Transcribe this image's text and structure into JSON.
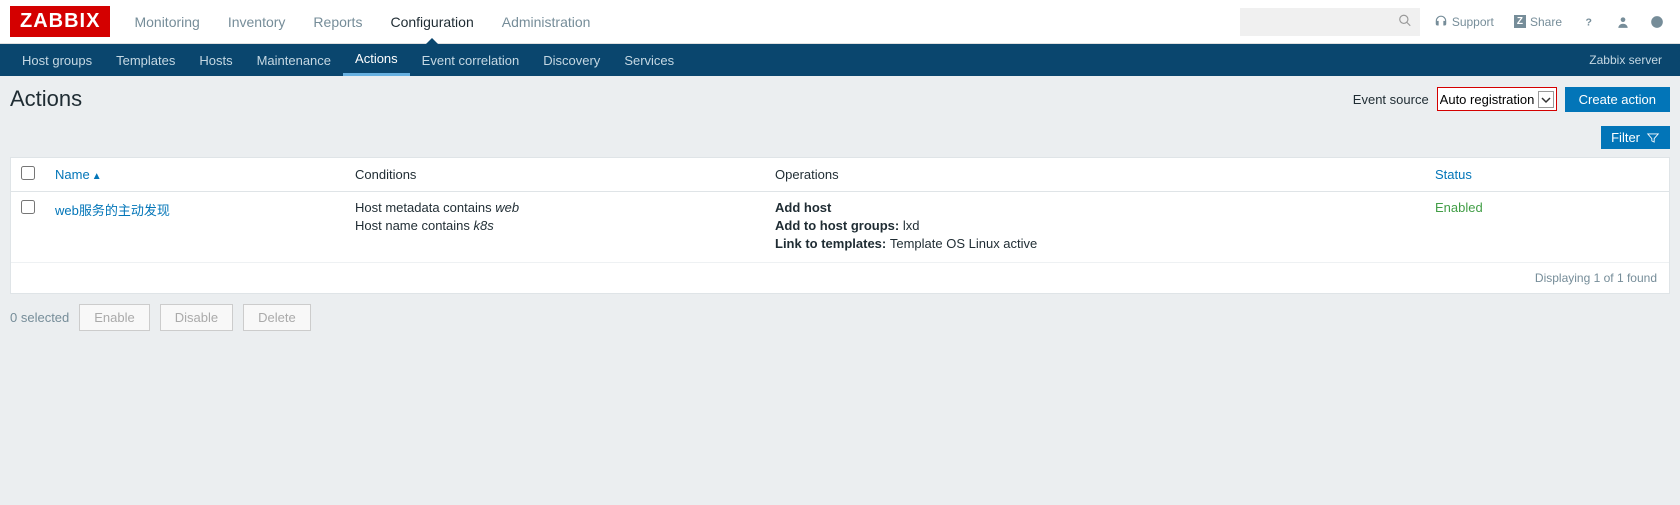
{
  "logo": "ZABBIX",
  "topnav": {
    "items": [
      {
        "label": "Monitoring"
      },
      {
        "label": "Inventory"
      },
      {
        "label": "Reports"
      },
      {
        "label": "Configuration"
      },
      {
        "label": "Administration"
      }
    ],
    "support": "Support",
    "share": "Share"
  },
  "subnav": {
    "items": [
      {
        "label": "Host groups"
      },
      {
        "label": "Templates"
      },
      {
        "label": "Hosts"
      },
      {
        "label": "Maintenance"
      },
      {
        "label": "Actions"
      },
      {
        "label": "Event correlation"
      },
      {
        "label": "Discovery"
      },
      {
        "label": "Services"
      }
    ],
    "server": "Zabbix server"
  },
  "page": {
    "title": "Actions",
    "event_source_label": "Event source",
    "event_source_value": "Auto registration",
    "create_button": "Create action",
    "filter_button": "Filter"
  },
  "table": {
    "headers": {
      "name": "Name",
      "conditions": "Conditions",
      "operations": "Operations",
      "status": "Status"
    },
    "rows": [
      {
        "name": "web服务的主动发现",
        "cond1_pre": "Host metadata contains ",
        "cond1_val": "web",
        "cond2_pre": "Host name contains ",
        "cond2_val": "k8s",
        "op1": "Add host",
        "op2_label": "Add to host groups: ",
        "op2_val": "lxd",
        "op3_label": "Link to templates: ",
        "op3_val": "Template OS Linux active",
        "status": "Enabled"
      }
    ],
    "footer": "Displaying 1 of 1 found"
  },
  "bottom": {
    "selected": "0 selected",
    "enable": "Enable",
    "disable": "Disable",
    "delete": "Delete"
  }
}
